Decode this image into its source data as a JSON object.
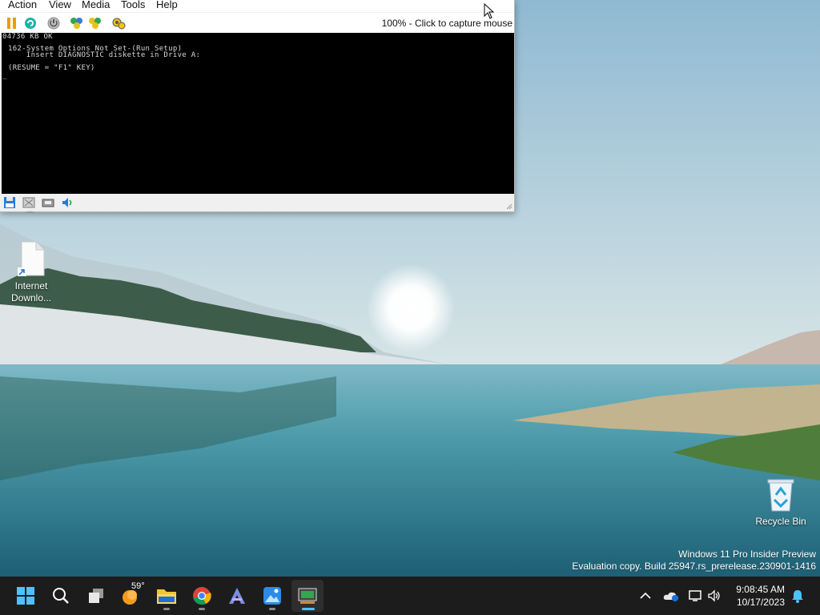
{
  "vm_window": {
    "menu": [
      "Action",
      "View",
      "Media",
      "Tools",
      "Help"
    ],
    "capture_status": "100% - Click to capture mouse",
    "console_lines": [
      "04736 KB OK",
      "162-System Options Not Set-(Run Setup)",
      "    Insert DIAGNOSTIC diskette in Drive A:",
      "(RESUME = \"F1\" KEY)",
      "_"
    ],
    "toolbar_icons": [
      "pause-icon",
      "reset-icon",
      "power-icon",
      "ctrl-alt-del-icon",
      "save-state-icon",
      "settings-icon"
    ],
    "status_icons": [
      "floppy-icon",
      "cdrom-icon",
      "network-icon",
      "sound-icon"
    ]
  },
  "desktop": {
    "partial_icon_label": "...",
    "internet_download_label": [
      "Internet",
      "Downlo..."
    ],
    "recycle_bin_label": "Recycle Bin",
    "watermark_line1": "Windows 11 Pro Insider Preview",
    "watermark_line2": "Evaluation copy. Build 25947.rs_prerelease.230901-1416"
  },
  "taskbar": {
    "weather_temp": "59°",
    "time": "9:08:45 AM",
    "date": "10/17/2023",
    "apps": [
      "start",
      "search",
      "task-view",
      "weather",
      "file-explorer",
      "chrome",
      "app",
      "photos",
      "86box"
    ]
  },
  "colors": {
    "accent": "#4cc2ff",
    "taskbar": "#1c1c1c",
    "vm_screen": "#000000"
  }
}
